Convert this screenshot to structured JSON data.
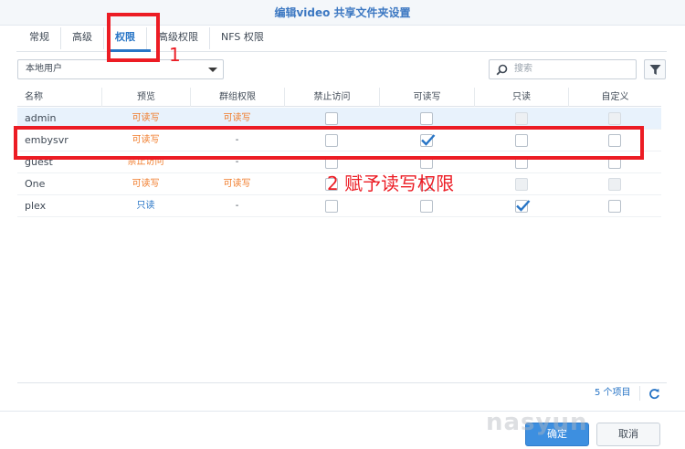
{
  "window": {
    "title": "编辑video 共享文件夹设置"
  },
  "tabs": [
    {
      "label": "常规",
      "active": false
    },
    {
      "label": "高级",
      "active": false
    },
    {
      "label": "权限",
      "active": true
    },
    {
      "label": "高级权限",
      "active": false
    },
    {
      "label": "NFS 权限",
      "active": false
    }
  ],
  "toolbar": {
    "user_type_selected": "本地用户",
    "search_placeholder": "搜索",
    "icons": {
      "search": "search-icon",
      "filter": "filter-icon"
    }
  },
  "table": {
    "columns": [
      "名称",
      "预览",
      "群组权限",
      "禁止访问",
      "可读写",
      "只读",
      "自定义"
    ],
    "rows": [
      {
        "name": "admin",
        "preview": "可读写",
        "preview_type": "rw",
        "group": "可读写",
        "deny": false,
        "rw": false,
        "ro": false,
        "custom": false,
        "ro_disabled": true,
        "custom_disabled": true,
        "selected": true
      },
      {
        "name": "embysvr",
        "preview": "可读写",
        "preview_type": "rw",
        "group": "-",
        "deny": false,
        "rw": true,
        "ro": false,
        "custom": false,
        "ro_disabled": false,
        "custom_disabled": false,
        "selected": false
      },
      {
        "name": "guest",
        "preview": "禁止访问",
        "preview_type": "deny",
        "group": "-",
        "deny": false,
        "rw": false,
        "ro": false,
        "custom": false,
        "ro_disabled": false,
        "custom_disabled": false,
        "selected": false
      },
      {
        "name": "One",
        "preview": "可读写",
        "preview_type": "rw",
        "group": "可读写",
        "deny": false,
        "rw": false,
        "ro": false,
        "custom": false,
        "ro_disabled": true,
        "custom_disabled": true,
        "selected": false
      },
      {
        "name": "plex",
        "preview": "只读",
        "preview_type": "ro",
        "group": "-",
        "deny": false,
        "rw": false,
        "ro": true,
        "custom": false,
        "ro_disabled": false,
        "custom_disabled": false,
        "selected": false
      }
    ]
  },
  "footer": {
    "item_count": "5 个项目"
  },
  "buttons": {
    "ok": "确定",
    "cancel": "取消"
  },
  "annotations": {
    "step1": "1",
    "step2": "2 赋予读写权限"
  },
  "watermark": "nasyun",
  "colors": {
    "accent": "#2875c6",
    "annotation": "#ec1c24",
    "rw": "#f07a28",
    "ro": "#2875c6"
  }
}
